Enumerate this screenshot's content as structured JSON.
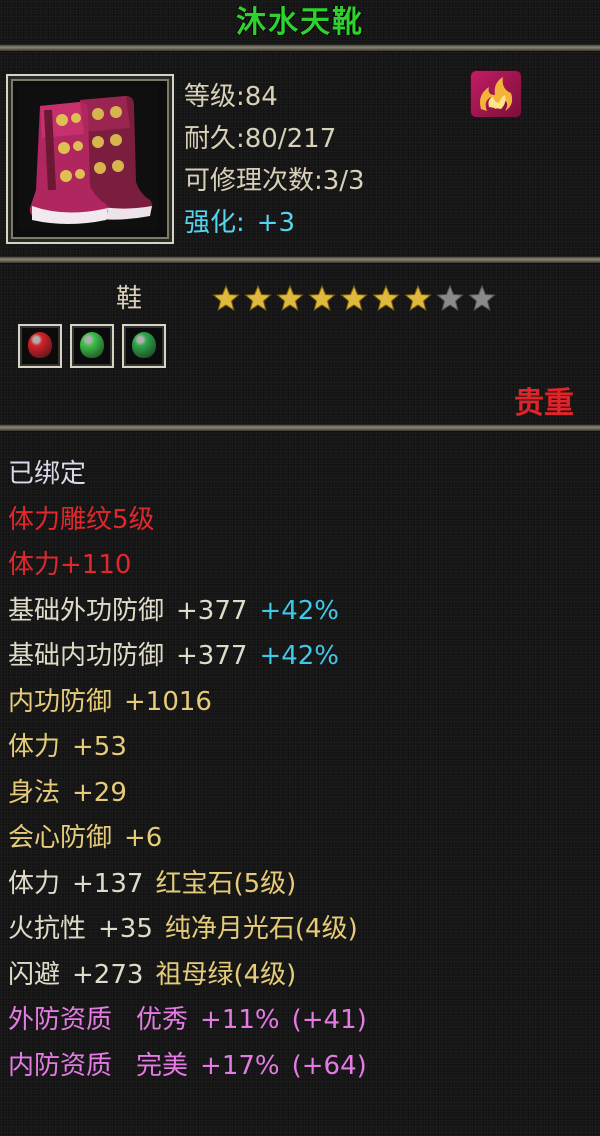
{
  "item": {
    "name": "沐水天靴",
    "level_label": "等级:84",
    "durability_label": "耐久:80/217",
    "repair_label": "可修理次数:3/3",
    "enhance_label": "强化:",
    "enhance_value": "+3",
    "type": "鞋",
    "stars_filled": 7,
    "stars_total": 9,
    "rarity": "贵重",
    "icon": "boots-icon",
    "class_icon": "flame-emblem-icon",
    "gems": [
      {
        "icon": "ruby-gem-icon",
        "color": "#d8222a"
      },
      {
        "icon": "jade-gem-icon",
        "color": "#3fc24a"
      },
      {
        "icon": "emerald-gem-icon",
        "color": "#2fa84a"
      }
    ]
  },
  "attributes": {
    "bound": "已绑定",
    "carving": "体力雕纹5级",
    "carving_bonus": "体力+110",
    "ext_def": {
      "label": "基础外功防御",
      "value": "+377",
      "pct": "+42%"
    },
    "int_def": {
      "label": "基础内功防御",
      "value": "+377",
      "pct": "+42%"
    },
    "int_def2": {
      "label": "内功防御",
      "value": "+1016"
    },
    "stamina": {
      "label": "体力",
      "value": "+53"
    },
    "agility": {
      "label": "身法",
      "value": "+29"
    },
    "crit_def": {
      "label": "会心防御",
      "value": "+6"
    },
    "gem1": {
      "label": "体力",
      "value": "+137",
      "gem": "红宝石(5级)"
    },
    "gem2": {
      "label": "火抗性",
      "value": "+35",
      "gem": "纯净月光石(4级)"
    },
    "gem3": {
      "label": "闪避",
      "value": "+273",
      "gem": "祖母绿(4级)"
    },
    "aptitude1": {
      "label": "外防资质",
      "grade": "优秀",
      "pct": "+11%",
      "bonus": "(+41)"
    },
    "aptitude2": {
      "label": "内防资质",
      "grade": "完美",
      "pct": "+17%",
      "bonus": "(+64)"
    }
  },
  "colors": {
    "title": "#2fd12f",
    "enhance": "#55d4f0",
    "rarity": "#e0242a",
    "star_filled": "#e0b93a",
    "star_empty": "#8a8a8a"
  }
}
